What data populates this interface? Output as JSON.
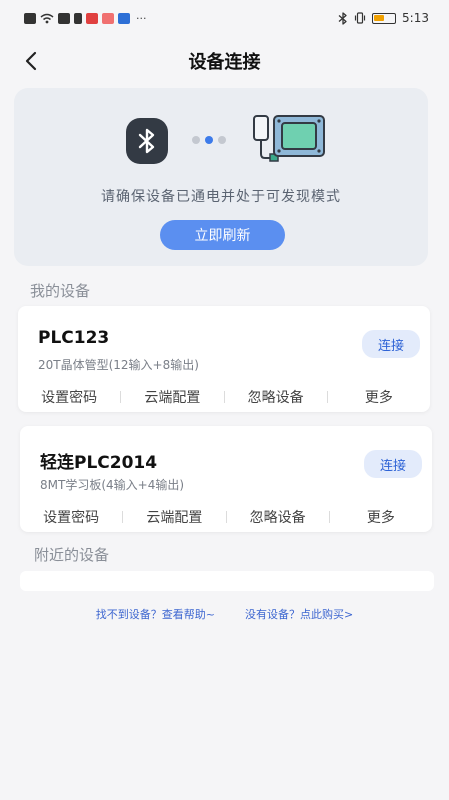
{
  "status_bar": {
    "time": "5:13",
    "overflow": "···"
  },
  "nav": {
    "title": "设备连接",
    "back_icon": "chevron-left-icon"
  },
  "hero": {
    "hint": "请确保设备已通电并处于可发现模式",
    "refresh_label": "立即刷新",
    "bluetooth_icon": "bluetooth-icon",
    "device_image": "plc-device-icon"
  },
  "my_devices": {
    "title": "我的设备",
    "items": [
      {
        "name": "PLC123",
        "desc": "20T晶体管型(12输入+8输出)",
        "connect_label": "连接"
      },
      {
        "name": "轻连PLC2014",
        "desc": "8MT学习板(4输入+4输出)",
        "connect_label": "连接"
      }
    ],
    "actions": [
      "设置密码",
      "云端配置",
      "忽略设备",
      "更多"
    ]
  },
  "nearby": {
    "title": "附近的设备"
  },
  "footer": {
    "help_link": "找不到设备？查看帮助~",
    "buy_link": "没有设备？点此购买>"
  },
  "colors": {
    "accent": "#5b8ff0",
    "link": "#3d66d0",
    "background": "#f5f5f7"
  }
}
